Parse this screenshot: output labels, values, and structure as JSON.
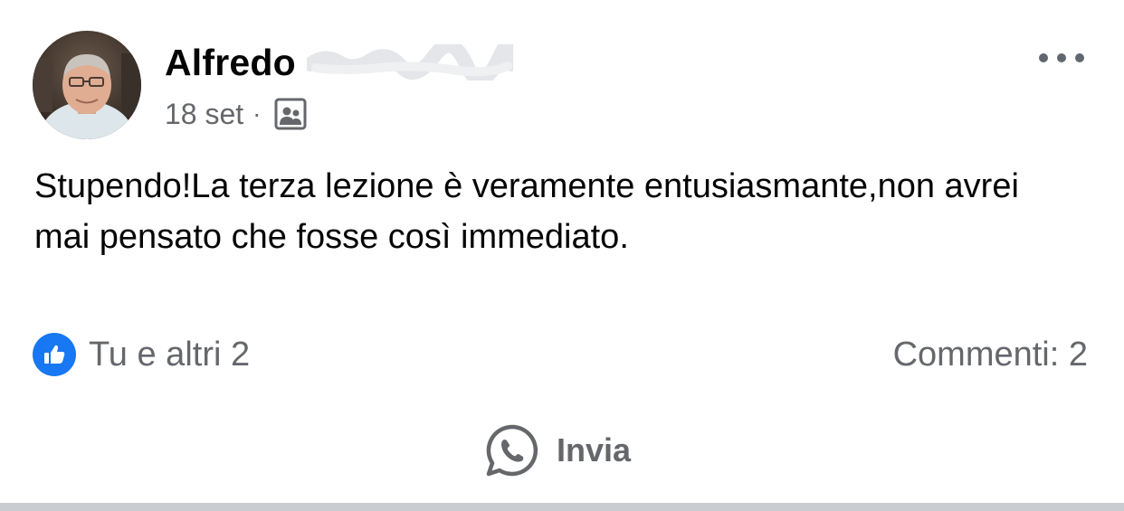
{
  "post": {
    "author": "Alfredo",
    "date": "18 set",
    "separator_dot": "·",
    "audience_icon": "group-audience-icon",
    "body": "Stupendo!La terza lezione è veramente entusiasmante,non avrei mai pensato che fosse così immediato.",
    "reactions": "Tu e altri 2",
    "comments": "Commenti: 2",
    "share_label": "Invia"
  },
  "icons": {
    "more": "more-options-icon",
    "like": "like-icon",
    "share": "whatsapp-icon"
  },
  "colors": {
    "like_blue": "#1877f2",
    "secondary_text": "#65676b",
    "primary_text": "#050505"
  }
}
